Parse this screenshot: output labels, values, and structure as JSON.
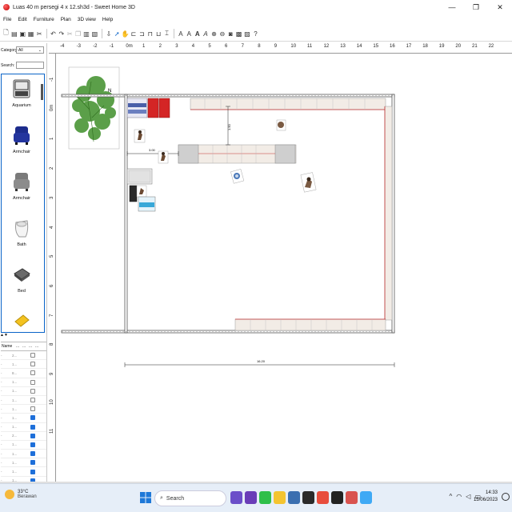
{
  "window": {
    "title": "Luas 40 m persegi 4 x 12.sh3d - Sweet Home 3D",
    "minimize": "—",
    "maximize": "❐",
    "close": "✕"
  },
  "menu": [
    "File",
    "Edit",
    "Furniture",
    "Plan",
    "3D view",
    "Help"
  ],
  "catalog": {
    "category_label": "Category:",
    "category_value": "All",
    "search_label": "Search:",
    "search_value": "",
    "items": [
      "Aquarium",
      "Armchair",
      "Armchair",
      "Bath",
      "Bed"
    ]
  },
  "furniture_table": {
    "headers": [
      "Name",
      "...",
      "...",
      "...",
      "..."
    ],
    "rows": [
      {
        "cells": [
          "-",
          "2..."
        ],
        "visible": false
      },
      {
        "cells": [
          "-",
          "1..."
        ],
        "visible": false
      },
      {
        "cells": [
          "-",
          "8..."
        ],
        "visible": false
      },
      {
        "cells": [
          "-",
          "1..."
        ],
        "visible": false
      },
      {
        "cells": [
          "-",
          "1..."
        ],
        "visible": false
      },
      {
        "cells": [
          "-",
          "1..."
        ],
        "visible": false
      },
      {
        "cells": [
          "-",
          "1..."
        ],
        "visible": false
      },
      {
        "cells": [
          "-",
          "1..."
        ],
        "visible": true
      },
      {
        "cells": [
          "-",
          "1..."
        ],
        "visible": true
      },
      {
        "cells": [
          "-",
          "2..."
        ],
        "visible": true
      },
      {
        "cells": [
          "-",
          "1..."
        ],
        "visible": true
      },
      {
        "cells": [
          "-",
          "1..."
        ],
        "visible": true
      },
      {
        "cells": [
          "-",
          "1..."
        ],
        "visible": true
      },
      {
        "cells": [
          "-",
          "1..."
        ],
        "visible": true
      },
      {
        "cells": [
          "-",
          "1..."
        ],
        "visible": true
      }
    ]
  },
  "plan": {
    "ruler_h": [
      "-4",
      "-3",
      "-2",
      "-1",
      "0m",
      "1",
      "2",
      "3",
      "4",
      "5",
      "6",
      "7",
      "8",
      "9",
      "10",
      "11",
      "12",
      "13",
      "14",
      "15",
      "16",
      "17",
      "18",
      "19",
      "20",
      "21",
      "22"
    ],
    "ruler_v": [
      "-1",
      "0m",
      "1",
      "2",
      "3",
      "4",
      "5",
      "6",
      "7",
      "8",
      "9",
      "10",
      "11"
    ],
    "dim_width": "16.20",
    "dim_short": "3.00",
    "dim_vertical": "1.50",
    "compass_label": "N"
  },
  "taskbar": {
    "temperature": "33°C",
    "weather": "Berawan",
    "search": "Search",
    "time": "14:33",
    "date": "15/06/2023"
  },
  "colors": {
    "accent": "#0a64c8",
    "wall": "#555555",
    "counter": "#f2ece6",
    "counter_line": "#c03030",
    "red_sofa": "#d42525"
  }
}
